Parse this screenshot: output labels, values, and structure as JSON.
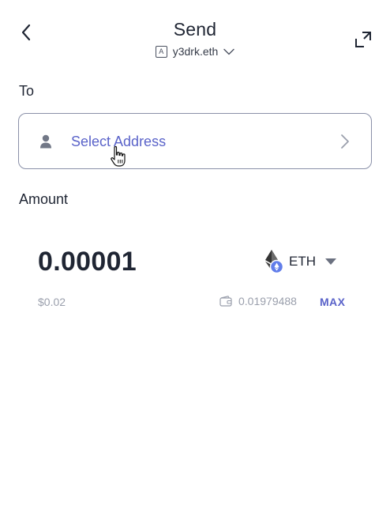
{
  "header": {
    "title": "Send",
    "account_badge": "A",
    "account_name": "y3drk.eth"
  },
  "recipient": {
    "label": "To",
    "select_address_label": "Select Address"
  },
  "amount": {
    "label": "Amount",
    "value": "0.00001",
    "token_symbol": "ETH",
    "fiat_value": "$0.02",
    "balance": "0.01979488",
    "max_label": "MAX"
  },
  "colors": {
    "text_primary": "#1f2533",
    "accent": "#5a63c9",
    "muted": "#9a9fac",
    "border": "#8a90a8"
  },
  "icons": {
    "back": "chevron-left-icon",
    "expand": "expand-icon",
    "account_dropdown": "chevron-down-icon",
    "user": "user-icon",
    "address_arrow": "chevron-right-icon",
    "token": "ethereum-icon",
    "wallet": "wallet-icon",
    "cursor": "hand-pointer-icon"
  }
}
